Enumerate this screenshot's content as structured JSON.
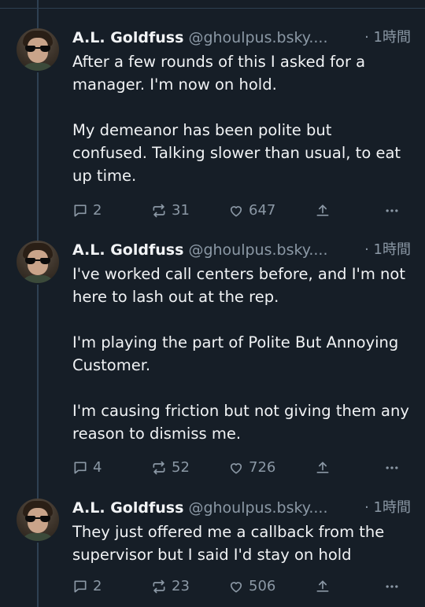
{
  "posts": [
    {
      "author_name": "A.L. Goldfuss",
      "handle": "@ghoulpus.bsky....",
      "time": "· 1時間",
      "paragraphs": [
        "After a few rounds of this I asked for a manager. I'm now on hold.",
        "My demeanor has been polite but confused. Talking slower than usual, to eat up time."
      ],
      "replies": "2",
      "reposts": "31",
      "likes": "647"
    },
    {
      "author_name": "A.L. Goldfuss",
      "handle": "@ghoulpus.bsky....",
      "time": "· 1時間",
      "paragraphs": [
        "I've worked call centers before, and I'm not here to lash out at the rep.",
        "I'm playing the part of Polite But Annoying Customer.",
        "I'm causing friction but not giving them any reason to dismiss me."
      ],
      "replies": "4",
      "reposts": "52",
      "likes": "726"
    },
    {
      "author_name": "A.L. Goldfuss",
      "handle": "@ghoulpus.bsky....",
      "time": "· 1時間",
      "paragraphs": [
        "They just offered me a callback from the supervisor but I said I'd stay on hold"
      ],
      "replies": "2",
      "reposts": "23",
      "likes": "506"
    }
  ],
  "icons": {
    "reply": "speech-bubble-icon",
    "repost": "repost-arrows-icon",
    "like": "heart-icon",
    "share": "share-upload-icon",
    "more": "more-dots-icon"
  },
  "colors": {
    "background": "#161e27",
    "text": "#f1f3f5",
    "muted": "#8b98a5",
    "thread_line": "#2e4052"
  }
}
